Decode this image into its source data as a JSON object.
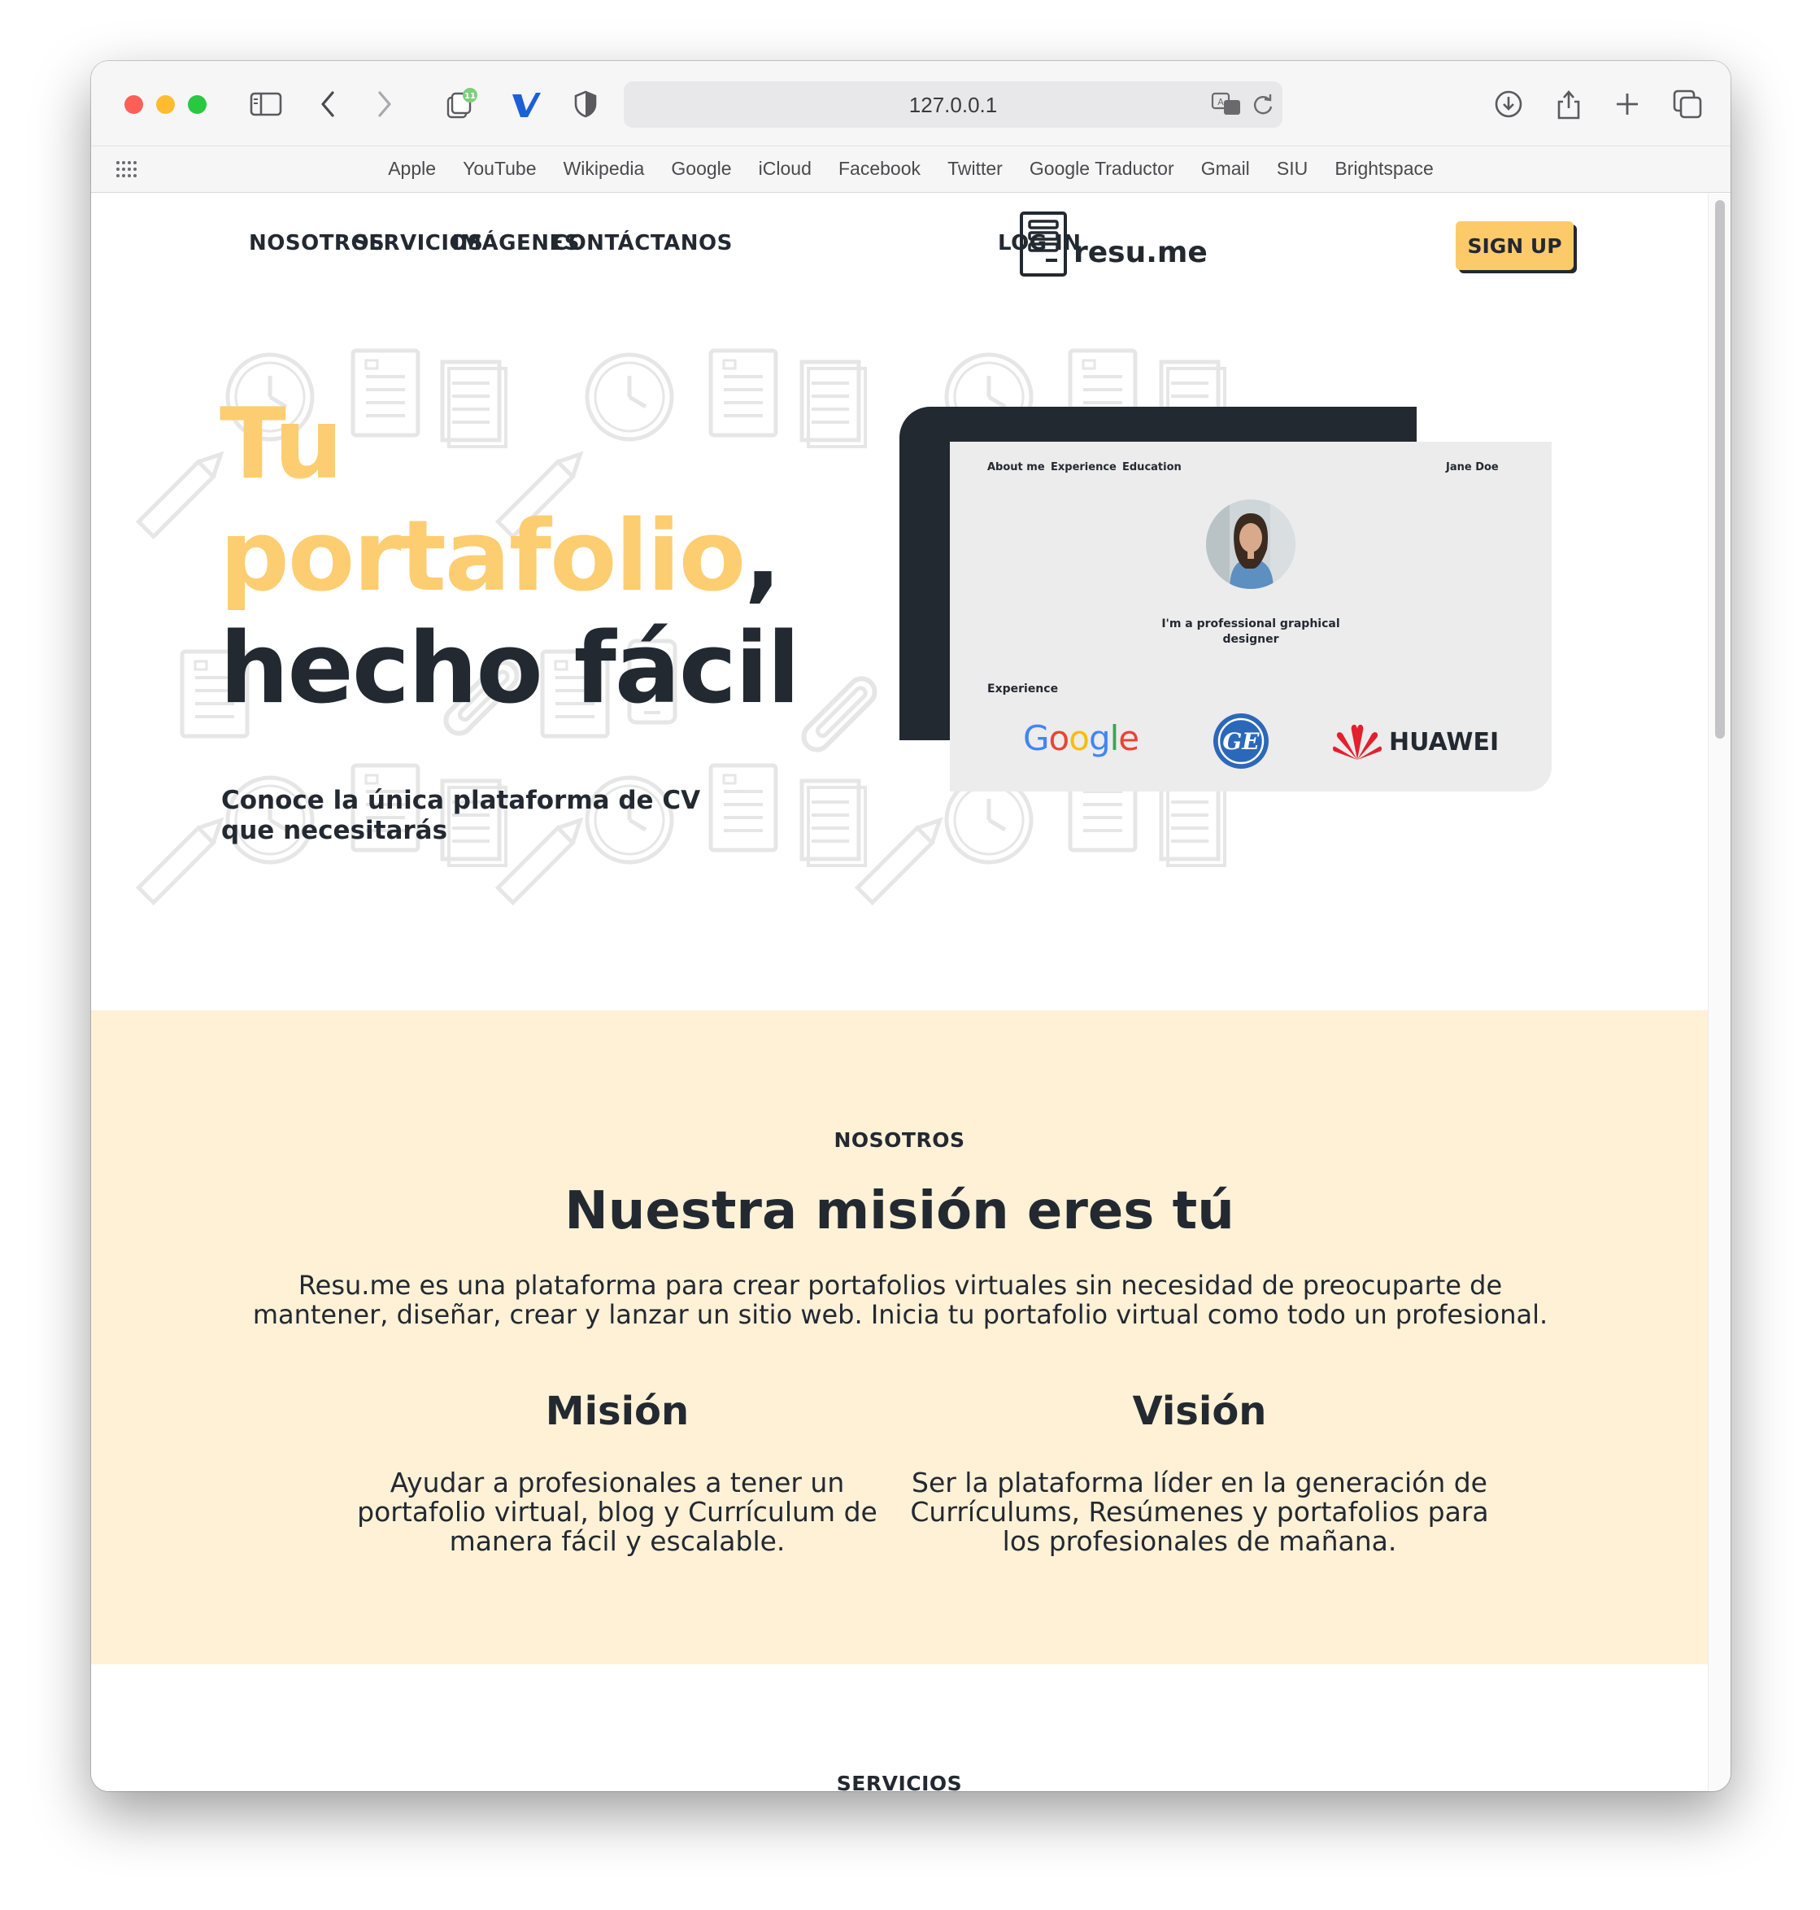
{
  "browser": {
    "url": "127.0.0.1",
    "favorites": [
      "Apple",
      "YouTube",
      "Wikipedia",
      "Google",
      "iCloud",
      "Facebook",
      "Twitter",
      "Google Traductor",
      "Gmail",
      "SIU",
      "Brightspace"
    ],
    "extension_badge": "11"
  },
  "nav": {
    "items": [
      "NOSOTROS",
      "SERVICIOS",
      "IMÁGENES",
      "CONTÁCTANOS"
    ],
    "logo_text": "resu.me",
    "login": "LOG IN",
    "signup": "SIGN UP"
  },
  "hero": {
    "title_line1": "Tu",
    "title_line2": "portafolio",
    "title_comma": ",",
    "title_line3": "hecho fácil",
    "subtitle": "Conoce la única plataforma de CV que necesitarás"
  },
  "preview": {
    "nav_links": [
      "About me",
      "Experience",
      "Education"
    ],
    "name": "Jane Doe",
    "tagline": "I'm a professional graphical designer",
    "experience_label": "Experience",
    "companies": [
      "Google",
      "GE",
      "HUAWEI"
    ]
  },
  "about": {
    "eyebrow": "NOSOTROS",
    "title": "Nuestra misión eres tú",
    "description": "Resu.me es una plataforma para crear portafolios virtuales sin necesidad de preocuparte de mantener, diseñar, crear y lanzar un sitio web. Inicia tu portafolio virtual como todo un profesional.",
    "mission_title": "Misión",
    "mission_text": "Ayudar a profesionales a tener un portafolio virtual, blog y Currículum de manera fácil y escalable.",
    "vision_title": "Visión",
    "vision_text": "Ser la plataforma líder en la generación de Currículums, Resúmenes y portafolios para los profesionales de mañana."
  },
  "services": {
    "eyebrow": "SERVICIOS"
  },
  "colors": {
    "accent": "#fdca6a",
    "dark": "#232931",
    "section_bg": "#fef1d6"
  }
}
